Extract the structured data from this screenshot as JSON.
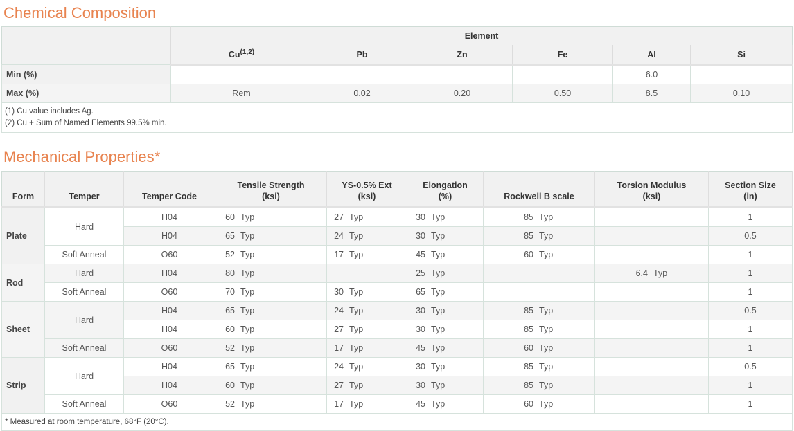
{
  "chem": {
    "title": "Chemical Composition",
    "group_header": "Element",
    "elements": [
      {
        "symbol": "Cu",
        "sup": "(1,2)"
      },
      {
        "symbol": "Pb",
        "sup": ""
      },
      {
        "symbol": "Zn",
        "sup": ""
      },
      {
        "symbol": "Fe",
        "sup": ""
      },
      {
        "symbol": "Al",
        "sup": ""
      },
      {
        "symbol": "Si",
        "sup": ""
      }
    ],
    "rows": [
      {
        "label": "Min (%)",
        "values": [
          "",
          "",
          "",
          "",
          "6.0",
          ""
        ]
      },
      {
        "label": "Max (%)",
        "values": [
          "Rem",
          "0.02",
          "0.20",
          "0.50",
          "8.5",
          "0.10"
        ]
      }
    ],
    "notes": [
      "(1) Cu value includes Ag.",
      "(2) Cu + Sum of Named Elements 99.5% min."
    ]
  },
  "mech": {
    "title": "Mechanical Properties*",
    "headers": {
      "form": "Form",
      "temper": "Temper",
      "temper_code": "Temper Code",
      "tensile_1": "Tensile Strength",
      "tensile_2": "(ksi)",
      "ys_1": "YS-0.5% Ext",
      "ys_2": "(ksi)",
      "elong_1": "Elongation",
      "elong_2": "(%)",
      "rockwell": "Rockwell B scale",
      "torsion_1": "Torsion Modulus",
      "torsion_2": "(ksi)",
      "section_1": "Section Size",
      "section_2": "(in)"
    },
    "typ": "Typ",
    "forms": [
      "Plate",
      "Rod",
      "Sheet",
      "Strip"
    ],
    "tempers": [
      "Hard",
      "Soft Anneal",
      "Hard",
      "Soft Anneal",
      "Hard",
      "Soft Anneal",
      "Hard",
      "Soft Anneal"
    ],
    "rows": [
      {
        "code": "H04",
        "tensile": "60",
        "ys": "27",
        "elong": "30",
        "rockwell": "85",
        "torsion": "",
        "section": "1"
      },
      {
        "code": "H04",
        "tensile": "65",
        "ys": "24",
        "elong": "30",
        "rockwell": "85",
        "torsion": "",
        "section": "0.5"
      },
      {
        "code": "O60",
        "tensile": "52",
        "ys": "17",
        "elong": "45",
        "rockwell": "60",
        "torsion": "",
        "section": "1"
      },
      {
        "code": "H04",
        "tensile": "80",
        "ys": "",
        "elong": "25",
        "rockwell": "",
        "torsion": "6.4",
        "section": "1"
      },
      {
        "code": "O60",
        "tensile": "70",
        "ys": "30",
        "elong": "65",
        "rockwell": "",
        "torsion": "",
        "section": "1"
      },
      {
        "code": "H04",
        "tensile": "65",
        "ys": "24",
        "elong": "30",
        "rockwell": "85",
        "torsion": "",
        "section": "0.5"
      },
      {
        "code": "H04",
        "tensile": "60",
        "ys": "27",
        "elong": "30",
        "rockwell": "85",
        "torsion": "",
        "section": "1"
      },
      {
        "code": "O60",
        "tensile": "52",
        "ys": "17",
        "elong": "45",
        "rockwell": "60",
        "torsion": "",
        "section": "1"
      },
      {
        "code": "H04",
        "tensile": "65",
        "ys": "24",
        "elong": "30",
        "rockwell": "85",
        "torsion": "",
        "section": "0.5"
      },
      {
        "code": "H04",
        "tensile": "60",
        "ys": "27",
        "elong": "30",
        "rockwell": "85",
        "torsion": "",
        "section": "1"
      },
      {
        "code": "O60",
        "tensile": "52",
        "ys": "17",
        "elong": "45",
        "rockwell": "60",
        "torsion": "",
        "section": "1"
      }
    ],
    "footnote": "* Measured at room temperature, 68°F (20°C)."
  }
}
